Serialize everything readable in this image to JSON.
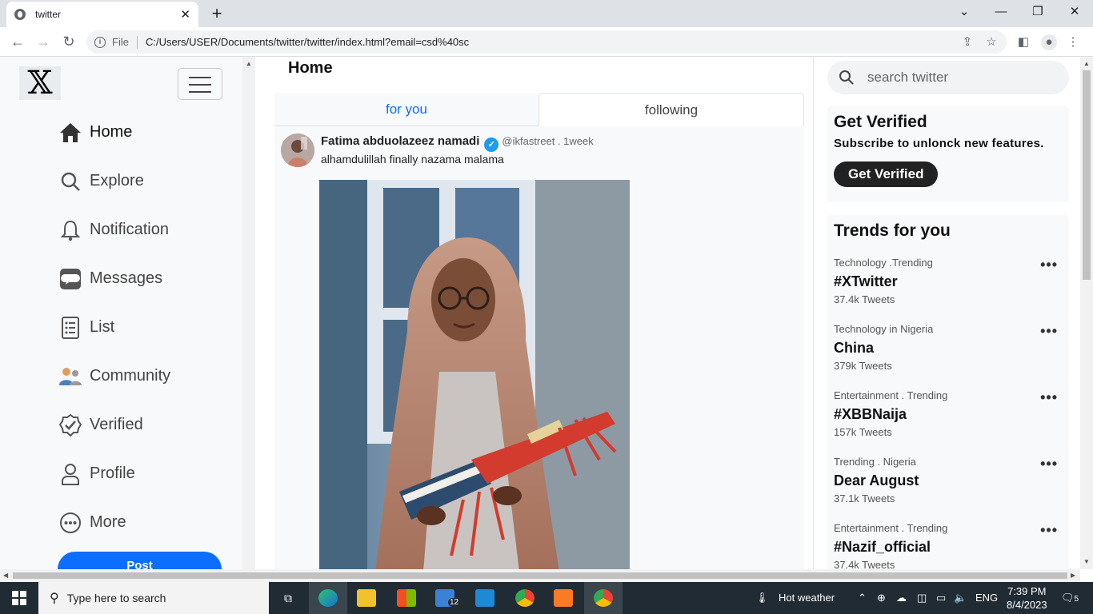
{
  "browser": {
    "tab_title": "twitter",
    "tab_close": "✕",
    "new_tab": "+",
    "file_label": "File",
    "url": "C:/Users/USER/Documents/twitter/twitter/index.html?email=csd%40sc"
  },
  "sidebar": {
    "logo": "𝕏",
    "items": [
      {
        "label": "Home",
        "icon": "home-icon"
      },
      {
        "label": "Explore",
        "icon": "search-icon"
      },
      {
        "label": "Notification",
        "icon": "bell-icon"
      },
      {
        "label": "Messages",
        "icon": "message-icon"
      },
      {
        "label": "List",
        "icon": "list-icon"
      },
      {
        "label": "Community",
        "icon": "people-icon"
      },
      {
        "label": "Verified",
        "icon": "verified-icon"
      },
      {
        "label": "Profile",
        "icon": "person-icon"
      },
      {
        "label": "More",
        "icon": "more-icon"
      }
    ],
    "post_label": "Post"
  },
  "main": {
    "title": "Home",
    "tabs": [
      "for you",
      "following"
    ],
    "tweet": {
      "name": "Fatima abduolazeez namadi",
      "handle": "@ikfastreet . 1week",
      "text": "alhamdulillah finally nazama malama"
    }
  },
  "right": {
    "search_placeholder": "search twitter",
    "verify": {
      "title": "Get Verified",
      "subtitle": "Subscribe to unlonck new features.",
      "button": "Get Verified"
    },
    "trends_title": "Trends for you",
    "trends": [
      {
        "category": "Technology .Trending",
        "tag": "#XTwitter",
        "count": "37.4k Tweets"
      },
      {
        "category": "Technology in Nigeria",
        "tag": "China",
        "count": "379k Tweets"
      },
      {
        "category": "Entertainment . Trending",
        "tag": "#XBBNaija",
        "count": "157k Tweets"
      },
      {
        "category": "Trending . Nigeria",
        "tag": "Dear August",
        "count": "37.1k Tweets"
      },
      {
        "category": "Entertainment . Trending",
        "tag": "#Nazif_official",
        "count": "37.4k Tweets"
      }
    ],
    "more_glyph": "•••"
  },
  "taskbar": {
    "search_placeholder": "Type here to search",
    "mail_badge": "12",
    "weather": "Hot weather",
    "lang": "ENG",
    "time": "7:39 PM",
    "date": "8/4/2023",
    "notif_count": "5"
  }
}
